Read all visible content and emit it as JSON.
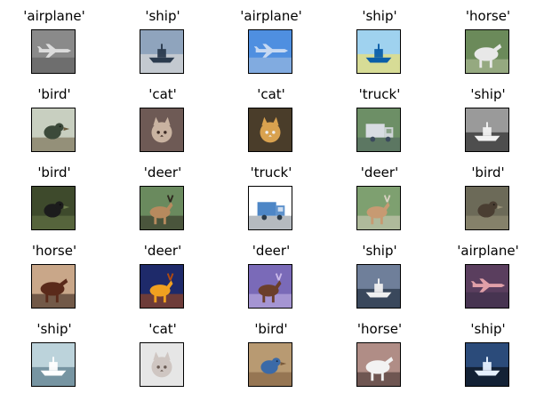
{
  "images": [
    {
      "label": "'airplane'",
      "subject": "airplane",
      "palette": [
        "#8a8a8a",
        "#dcdcdc",
        "#3a3a3a"
      ]
    },
    {
      "label": "'ship'",
      "subject": "ship",
      "palette": [
        "#8fa4bd",
        "#2b3b4e",
        "#d8d8d8"
      ]
    },
    {
      "label": "'airplane'",
      "subject": "airplane",
      "palette": [
        "#4f8fe0",
        "#c7d9f2",
        "#e0e0e0"
      ]
    },
    {
      "label": "'ship'",
      "subject": "ship",
      "palette": [
        "#9fd2ef",
        "#0b5ea8",
        "#f0e070"
      ]
    },
    {
      "label": "'horse'",
      "subject": "horse",
      "palette": [
        "#6b8a5a",
        "#e8e8e8",
        "#b8c3a0"
      ]
    },
    {
      "label": "'bird'",
      "subject": "bird",
      "palette": [
        "#c8cfc0",
        "#3c4a3a",
        "#6a5c3e"
      ]
    },
    {
      "label": "'cat'",
      "subject": "cat",
      "palette": [
        "#6e5a55",
        "#c9b3a1",
        "#3b2a24"
      ]
    },
    {
      "label": "'cat'",
      "subject": "cat",
      "palette": [
        "#4a3d2a",
        "#d9a24f",
        "#f0f0f0"
      ]
    },
    {
      "label": "'truck'",
      "subject": "truck",
      "palette": [
        "#6d8f66",
        "#d8dce2",
        "#3b4a5c"
      ]
    },
    {
      "label": "'ship'",
      "subject": "ship",
      "palette": [
        "#9a9a9a",
        "#f2f2f2",
        "#2e2e2e"
      ]
    },
    {
      "label": "'bird'",
      "subject": "bird",
      "palette": [
        "#3e4a2c",
        "#1c1c1c",
        "#6a7a4a"
      ]
    },
    {
      "label": "'deer'",
      "subject": "deer",
      "palette": [
        "#6a8a5e",
        "#b78a5e",
        "#2f2a20"
      ]
    },
    {
      "label": "'truck'",
      "subject": "truck",
      "palette": [
        "#ffffff",
        "#4d86c6",
        "#2b3a48"
      ]
    },
    {
      "label": "'deer'",
      "subject": "deer",
      "palette": [
        "#7ea070",
        "#c79a72",
        "#d7d0c0"
      ]
    },
    {
      "label": "'bird'",
      "subject": "bird",
      "palette": [
        "#6c6a58",
        "#4a3e32",
        "#9a937a"
      ]
    },
    {
      "label": "'horse'",
      "subject": "horse",
      "palette": [
        "#c9a789",
        "#5a2a1a",
        "#2a1a12"
      ]
    },
    {
      "label": "'deer'",
      "subject": "deer",
      "palette": [
        "#1e2a6a",
        "#f0a020",
        "#b04a10"
      ]
    },
    {
      "label": "'deer'",
      "subject": "deer",
      "palette": [
        "#7a6ab8",
        "#6b3f2a",
        "#c9b8e8"
      ]
    },
    {
      "label": "'ship'",
      "subject": "ship",
      "palette": [
        "#6f7f9a",
        "#f0f0f0",
        "#243042"
      ]
    },
    {
      "label": "'airplane'",
      "subject": "airplane",
      "palette": [
        "#5a3e5e",
        "#e0a0a8",
        "#24213a"
      ]
    },
    {
      "label": "'ship'",
      "subject": "ship",
      "palette": [
        "#bcd3db",
        "#ffffff",
        "#5a7a8a"
      ]
    },
    {
      "label": "'cat'",
      "subject": "cat",
      "palette": [
        "#e6e6e6",
        "#cfc6c2",
        "#6b5c55"
      ]
    },
    {
      "label": "'bird'",
      "subject": "bird",
      "palette": [
        "#b89a72",
        "#3b6aa8",
        "#7a5a3a"
      ]
    },
    {
      "label": "'horse'",
      "subject": "horse",
      "palette": [
        "#b08d86",
        "#f2f2f2",
        "#3a2a28"
      ]
    },
    {
      "label": "'ship'",
      "subject": "ship",
      "palette": [
        "#2b4b7a",
        "#e6f0ff",
        "#0a0f18"
      ]
    }
  ]
}
